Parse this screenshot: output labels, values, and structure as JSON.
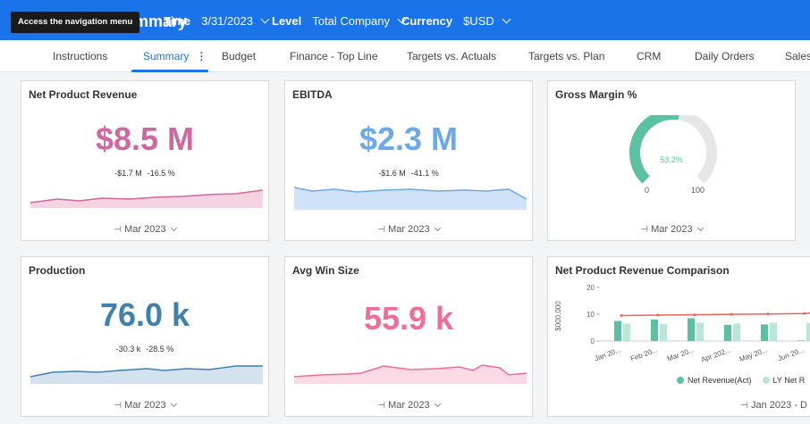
{
  "header": {
    "tooltip": "Access the navigation menu",
    "title": "Company Summary",
    "filters": [
      {
        "label": "Time",
        "value": "3/31/2023"
      },
      {
        "label": "Level",
        "value": "Total Company"
      },
      {
        "label": "Currency",
        "value": "$USD"
      }
    ]
  },
  "tabs": [
    "Instructions",
    "Summary",
    "Budget",
    "Finance - Top Line",
    "Targets vs. Actuals",
    "Targets vs. Plan",
    "CRM",
    "Daily Orders",
    "Sales"
  ],
  "active_tab": "Summary",
  "colors": {
    "brand": "#1a73e8",
    "pink": "#d0679e",
    "blue": "#6aa9ea",
    "steel": "#3f80ad",
    "rose": "#f06d98",
    "teal": "#5cc1a2",
    "light_teal": "#b9e6d9",
    "red_line": "#e8645a"
  },
  "cards": {
    "npr": {
      "title": "Net Product Revenue",
      "value": "$8.5 M",
      "delta_abs": "-$1.7 M",
      "delta_pct": "-16.5 %",
      "period": "Mar 2023"
    },
    "ebitda": {
      "title": "EBITDA",
      "value": "$2.3 M",
      "delta_abs": "-$1.6 M",
      "delta_pct": "-41.1 %",
      "period": "Mar 2023"
    },
    "gm": {
      "title": "Gross Margin %",
      "value": "53.2%",
      "min": "0",
      "max": "100",
      "level": 53.2,
      "period": "Mar 2023"
    },
    "production": {
      "title": "Production",
      "value": "76.0 k",
      "delta_abs": "-30.3 k",
      "delta_pct": "-28.5 %",
      "period": "Mar 2023"
    },
    "aws": {
      "title": "Avg Win Size",
      "value": "55.9 k",
      "period": "Mar 2023"
    },
    "nprc": {
      "title": "Net Product Revenue Comparison",
      "ylabel": "$000,000",
      "period": "Jan 2023 - D",
      "legend": [
        "Net Revenue(Act)",
        "LY Net R"
      ],
      "yticks": [
        "20",
        "10",
        "0"
      ]
    }
  },
  "chart_data": {
    "type": "bar",
    "title": "Net Product Revenue Comparison",
    "ylabel": "$000,000",
    "ylim": [
      0,
      20
    ],
    "categories": [
      "Jan 20...",
      "Feb 20...",
      "Mar 20...",
      "Apr 202...",
      "May 20...",
      "Jun 20..."
    ],
    "series": [
      {
        "name": "Net Revenue(Act)",
        "values": [
          7.5,
          8,
          8.5,
          6,
          6.2,
          0.2
        ]
      },
      {
        "name": "LY Net R",
        "values": [
          6.5,
          6.3,
          6.8,
          6.5,
          6.8,
          6.7
        ]
      }
    ]
  }
}
